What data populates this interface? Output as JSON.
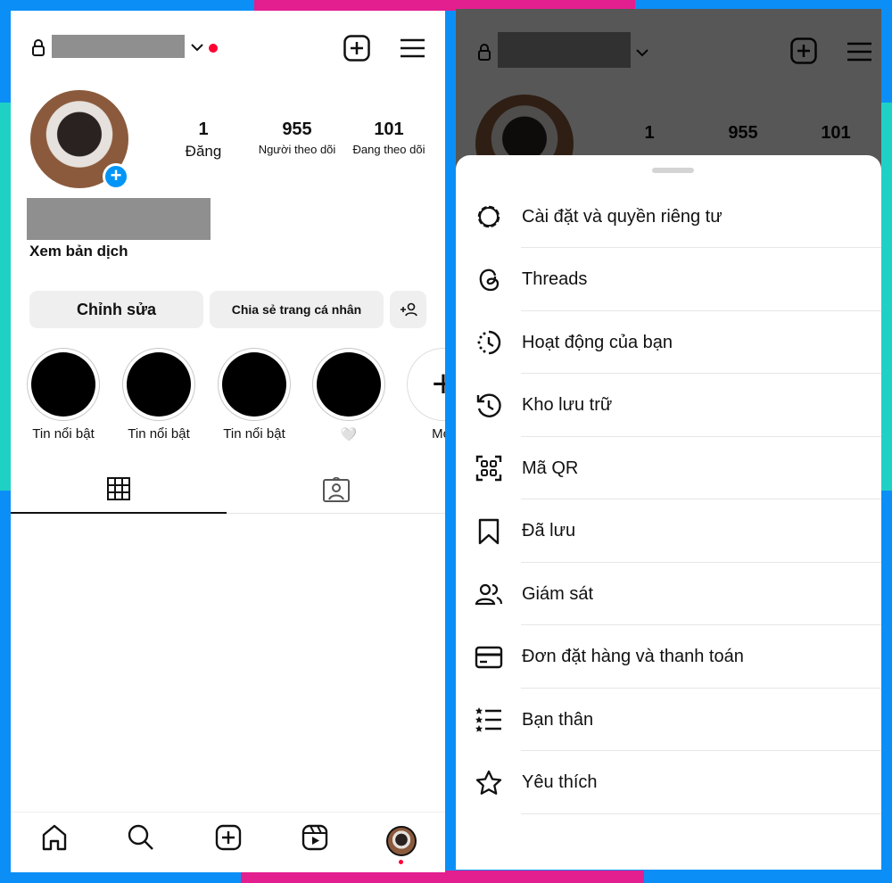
{
  "colors": {
    "blue": "#0b8ff7",
    "pink": "#e31e8f",
    "teal": "#1fd1c5",
    "accent": "#0095f6",
    "notify": "#ff0033"
  },
  "profile": {
    "posts": {
      "count": "1",
      "label": "Đăng"
    },
    "followers": {
      "count": "955",
      "label": "Người theo dõi"
    },
    "following": {
      "count": "101",
      "label": "Đang theo dõi"
    },
    "translate_link": "Xem bản dịch"
  },
  "buttons": {
    "edit": "Chỉnh sửa",
    "share": "Chia sẻ trang cá nhân"
  },
  "highlights": [
    {
      "label": "Tin nổi bật"
    },
    {
      "label": "Tin nổi bật"
    },
    {
      "label": "Tin nổi bật"
    },
    {
      "label": "🤍"
    },
    {
      "label": "Mới"
    }
  ],
  "menu": {
    "items": [
      {
        "label": "Cài đặt và quyền riêng tư",
        "icon": "settings-icon"
      },
      {
        "label": "Threads",
        "icon": "threads-icon"
      },
      {
        "label": "Hoạt động của bạn",
        "icon": "activity-icon"
      },
      {
        "label": "Kho lưu trữ",
        "icon": "archive-icon"
      },
      {
        "label": "Mã QR",
        "icon": "qr-code-icon"
      },
      {
        "label": "Đã lưu",
        "icon": "bookmark-icon"
      },
      {
        "label": "Giám sát",
        "icon": "supervision-icon"
      },
      {
        "label": "Đơn đặt hàng và thanh toán",
        "icon": "card-icon"
      },
      {
        "label": "Bạn thân",
        "icon": "close-friends-icon"
      },
      {
        "label": "Yêu thích",
        "icon": "star-icon"
      }
    ]
  }
}
